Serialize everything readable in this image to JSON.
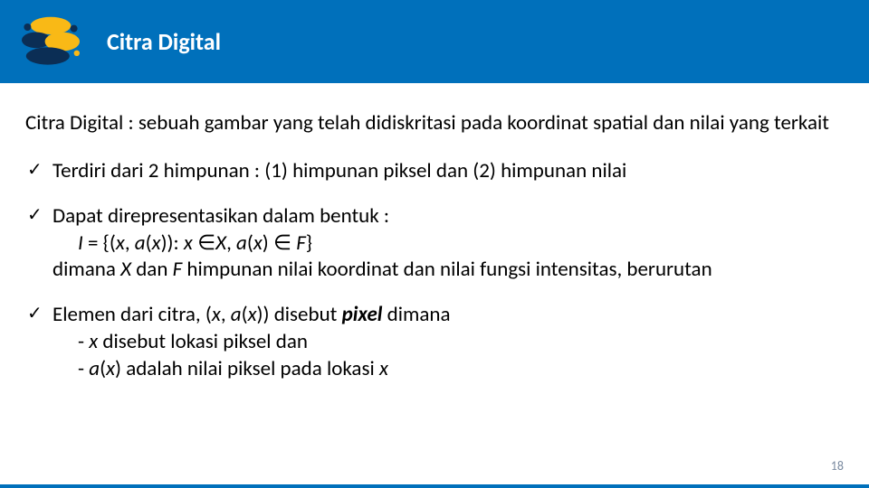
{
  "header": {
    "title": "Citra Digital"
  },
  "intro": "Citra Digital : sebuah gambar yang telah didiskritasi pada koordinat spatial dan nilai yang terkait",
  "bullets": {
    "b1": "Terdiri dari  2 himpunan : (1) himpunan piksel dan (2) himpunan nilai",
    "b2_lead": "Dapat direpresentasikan dalam bentuk :",
    "b2_formula_pre": "I ",
    "b2_formula_mid": "= {(",
    "b2_x1": "x",
    "b2_comma1": ", ",
    "b2_a1": "a",
    "b2_paren1": "(",
    "b2_x2": "x",
    "b2_paren2": ")): ",
    "b2_x3": "x ",
    "b2_in1": "∈",
    "b2_Xset": "X",
    "b2_comma2": ", ",
    "b2_a2": "a",
    "b2_paren3": "(",
    "b2_x4": "x",
    "b2_paren4": ") ∈ ",
    "b2_F": "F",
    "b2_close": "}",
    "b2_where_pre": "dimana ",
    "b2_where_X": "X",
    "b2_where_mid": " dan ",
    "b2_where_F": "F",
    "b2_where_post": " himpunan nilai koordinat dan nilai fungsi intensitas, berurutan",
    "b3_pre": "Elemen dari citra, (",
    "b3_x1": "x",
    "b3_c1": ", ",
    "b3_a": "a",
    "b3_p1": "(",
    "b3_x2": "x",
    "b3_p2": ")) disebut ",
    "b3_pixel": "pixel",
    "b3_post": " dimana",
    "b3_s1_pre": "- ",
    "b3_s1_x": "x",
    "b3_s1_post": " disebut lokasi piksel dan",
    "b3_s2_pre": "- ",
    "b3_s2_a": "a",
    "b3_s2_p1": "(",
    "b3_s2_x": "x",
    "b3_s2_p2": ") adalah nilai piksel pada lokasi ",
    "b3_s2_x2": "x"
  },
  "page": "18"
}
